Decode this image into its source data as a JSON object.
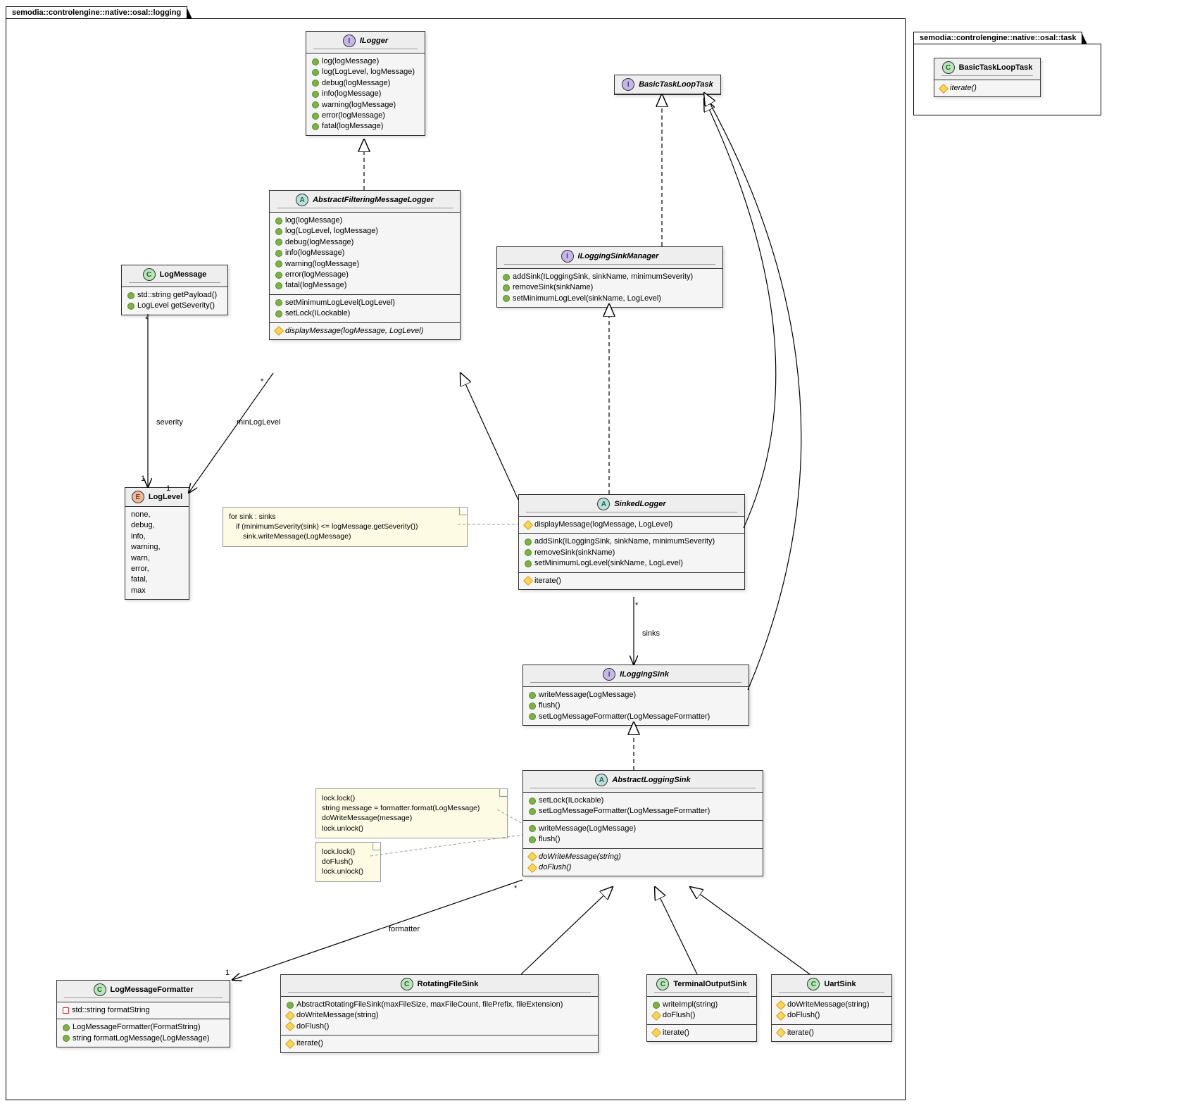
{
  "packages": {
    "logging": {
      "name": "semodia::controlengine::native::osal::logging"
    },
    "task": {
      "name": "semodia::controlengine::native::osal::task"
    }
  },
  "boxes": {
    "ILogger": {
      "stereotype": "I",
      "name": "ILogger",
      "italic": true,
      "methods": [
        {
          "vis": "public",
          "text": "log(logMessage)"
        },
        {
          "vis": "public",
          "text": "log(LogLevel, logMessage)"
        },
        {
          "vis": "public",
          "text": "debug(logMessage)"
        },
        {
          "vis": "public",
          "text": "info(logMessage)"
        },
        {
          "vis": "public",
          "text": "warning(logMessage)"
        },
        {
          "vis": "public",
          "text": "error(logMessage)"
        },
        {
          "vis": "public",
          "text": "fatal(logMessage)"
        }
      ]
    },
    "BasicTaskLoopTask_I": {
      "stereotype": "I",
      "name": "BasicTaskLoopTask",
      "italic": true
    },
    "BasicTaskLoopTask_C": {
      "stereotype": "C",
      "name": "BasicTaskLoopTask",
      "methods": [
        {
          "vis": "protected",
          "text": "iterate()",
          "italic": true
        }
      ]
    },
    "AbstractFilteringMessageLogger": {
      "stereotype": "A",
      "name": "AbstractFilteringMessageLogger",
      "italic": true,
      "sections": [
        [
          {
            "vis": "public",
            "text": "log(logMessage)"
          },
          {
            "vis": "public",
            "text": "log(LogLevel, logMessage)"
          },
          {
            "vis": "public",
            "text": "debug(logMessage)"
          },
          {
            "vis": "public",
            "text": "info(logMessage)"
          },
          {
            "vis": "public",
            "text": "warning(logMessage)"
          },
          {
            "vis": "public",
            "text": "error(logMessage)"
          },
          {
            "vis": "public",
            "text": "fatal(logMessage)"
          }
        ],
        [
          {
            "vis": "public",
            "text": "setMinimumLogLevel(LogLevel)"
          },
          {
            "vis": "public",
            "text": "setLock(ILockable)"
          }
        ],
        [
          {
            "vis": "protected",
            "text": "displayMessage(logMessage, LogLevel)",
            "italic": true
          }
        ]
      ]
    },
    "LogMessage": {
      "stereotype": "C",
      "name": "LogMessage",
      "methods": [
        {
          "vis": "public",
          "text": "std::string getPayload()"
        },
        {
          "vis": "public",
          "text": "LogLevel getSeverity()"
        }
      ]
    },
    "ILoggingSinkManager": {
      "stereotype": "I",
      "name": "ILoggingSinkManager",
      "italic": true,
      "methods": [
        {
          "vis": "public",
          "text": "addSink(ILoggingSink, sinkName, minimumSeverity)"
        },
        {
          "vis": "public",
          "text": "removeSink(sinkName)"
        },
        {
          "vis": "public",
          "text": "setMinimumLogLevel(sinkName, LogLevel)"
        }
      ]
    },
    "LogLevel": {
      "stereotype": "E",
      "name": "LogLevel",
      "literals": [
        "none,",
        "debug,",
        "info,",
        "warning,",
        "warn,",
        "error,",
        "fatal,",
        "max"
      ]
    },
    "SinkedLogger": {
      "stereotype": "A",
      "name": "SinkedLogger",
      "italic": true,
      "sections": [
        [
          {
            "vis": "protected",
            "text": "displayMessage(logMessage, LogLevel)"
          }
        ],
        [
          {
            "vis": "public",
            "text": "addSink(ILoggingSink, sinkName, minimumSeverity)"
          },
          {
            "vis": "public",
            "text": "removeSink(sinkName)"
          },
          {
            "vis": "public",
            "text": "setMinimumLogLevel(sinkName, LogLevel)"
          }
        ],
        [
          {
            "vis": "protected",
            "text": "iterate()"
          }
        ]
      ]
    },
    "ILoggingSink": {
      "stereotype": "I",
      "name": "ILoggingSink",
      "italic": true,
      "methods": [
        {
          "vis": "public",
          "text": "writeMessage(LogMessage)"
        },
        {
          "vis": "public",
          "text": "flush()"
        },
        {
          "vis": "public",
          "text": "setLogMessageFormatter(LogMessageFormatter)"
        }
      ]
    },
    "AbstractLoggingSink": {
      "stereotype": "A",
      "name": "AbstractLoggingSink",
      "italic": true,
      "sections": [
        [
          {
            "vis": "public",
            "text": "setLock(ILockable)"
          },
          {
            "vis": "public",
            "text": "setLogMessageFormatter(LogMessageFormatter)"
          }
        ],
        [
          {
            "vis": "public",
            "text": "writeMessage(LogMessage)"
          },
          {
            "vis": "public",
            "text": "flush()"
          }
        ],
        [
          {
            "vis": "protected",
            "text": "doWriteMessage(string)",
            "italic": true
          },
          {
            "vis": "protected",
            "text": "doFlush()",
            "italic": true
          }
        ]
      ]
    },
    "LogMessageFormatter": {
      "stereotype": "C",
      "name": "LogMessageFormatter",
      "sections": [
        [
          {
            "vis": "private",
            "text": "std::string formatString"
          }
        ],
        [
          {
            "vis": "public",
            "text": "LogMessageFormatter(FormatString)"
          },
          {
            "vis": "public",
            "text": "string formatLogMessage(LogMessage)"
          }
        ]
      ]
    },
    "RotatingFileSink": {
      "stereotype": "C",
      "name": "RotatingFileSink",
      "sections": [
        [
          {
            "vis": "public",
            "text": "AbstractRotatingFileSink(maxFileSize, maxFileCount, filePrefix, fileExtension)"
          },
          {
            "vis": "protected",
            "text": "doWriteMessage(string)"
          },
          {
            "vis": "protected",
            "text": "doFlush()"
          }
        ],
        [
          {
            "vis": "protected",
            "text": "iterate()"
          }
        ]
      ]
    },
    "TerminalOutputSink": {
      "stereotype": "C",
      "name": "TerminalOutputSink",
      "sections": [
        [
          {
            "vis": "public",
            "text": "writeImpl(string)"
          },
          {
            "vis": "protected",
            "text": "doFlush()"
          }
        ],
        [
          {
            "vis": "protected",
            "text": "iterate()"
          }
        ]
      ]
    },
    "UartSink": {
      "stereotype": "C",
      "name": "UartSink",
      "sections": [
        [
          {
            "vis": "protected",
            "text": "doWriteMessage(string)"
          },
          {
            "vis": "protected",
            "text": "doFlush()"
          }
        ],
        [
          {
            "vis": "protected",
            "text": "iterate()"
          }
        ]
      ]
    }
  },
  "notes": {
    "sinkedLoggerNote": {
      "lines": [
        "for sink : sinks",
        "  if (minimumSeverity(sink) <= logMessage.getSeverity())",
        "    sink.writeMessage(LogMessage)"
      ]
    },
    "writeMessageNote": {
      "lines": [
        "lock.lock()",
        "string message = formatter.format(LogMessage)",
        "doWriteMessage(message)",
        "lock.unlock()"
      ]
    },
    "flushNote": {
      "lines": [
        "lock.lock()",
        "doFlush()",
        "lock.unlock()"
      ]
    }
  },
  "labels": {
    "severity": "severity",
    "minLogLevel": "minLogLevel",
    "sinks": "sinks",
    "formatter": "formatter",
    "one_a": "1",
    "one_b": "1",
    "one_c": "1",
    "star_a": "*",
    "star_b": "*",
    "star_c": "*",
    "star_d": "*"
  }
}
